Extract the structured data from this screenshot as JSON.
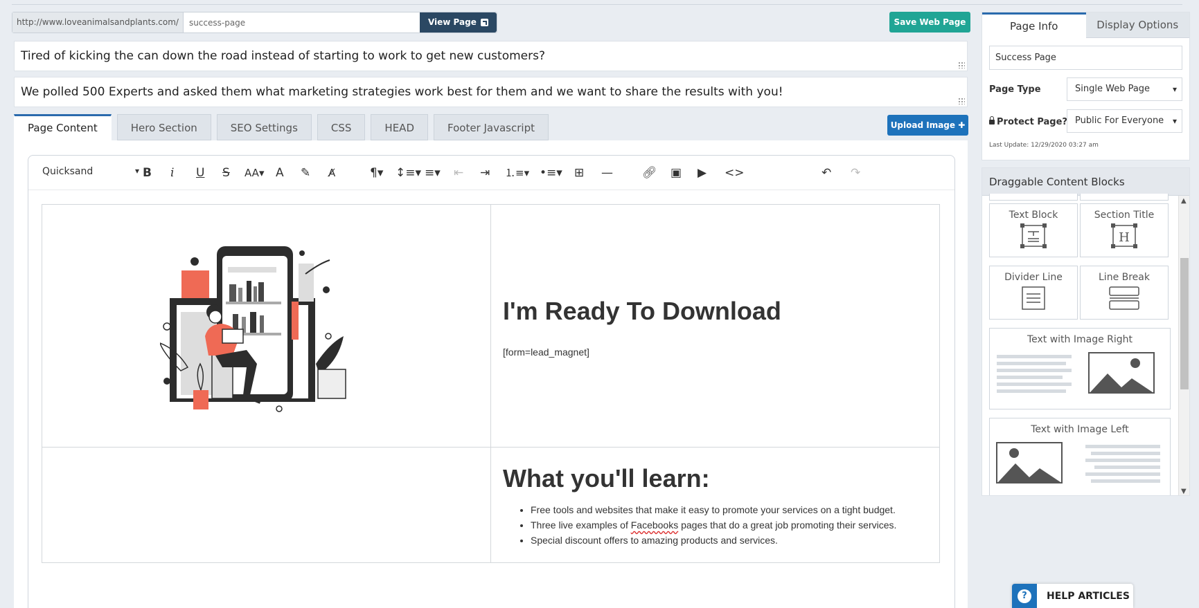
{
  "url_bar": {
    "prefix": "http://www.loveanimalsandplants.com/",
    "slug": "success-page",
    "view_label": "View Page"
  },
  "save_label": "Save Web Page",
  "headline_1": "Tired of kicking the can down the road instead of starting to work to get new customers?",
  "headline_2": "We polled 500 Experts and asked them what marketing strategies work best for them and we want to share the results with you!",
  "tabs": [
    {
      "label": "Page Content",
      "active": true
    },
    {
      "label": "Hero Section"
    },
    {
      "label": "SEO Settings"
    },
    {
      "label": "CSS"
    },
    {
      "label": "HEAD"
    },
    {
      "label": "Footer Javascript"
    }
  ],
  "upload_label": "Upload Image",
  "toolbar": {
    "font": "Quicksand",
    "icons": [
      "bold-icon",
      "italic-icon",
      "underline-icon",
      "strikethrough-icon",
      "font-size-icon",
      "text-color-icon",
      "highlight-icon",
      "clear-format-icon",
      "paragraph-icon",
      "line-height-icon",
      "align-icon",
      "outdent-icon",
      "indent-icon",
      "ordered-list-icon",
      "bullet-list-icon",
      "table-icon",
      "horizontal-rule-icon",
      "link-icon",
      "image-icon",
      "video-icon",
      "code-icon",
      "undo-icon",
      "redo-icon"
    ]
  },
  "content": {
    "ready_title": "I'm Ready To Download",
    "shortcode": "[form=lead_magnet]",
    "learn_title": "What you'll learn:",
    "learn_items": [
      {
        "before": "Free tools and websites that make it easy to promote your services on a tight budget.",
        "squiggle": "",
        "after": ""
      },
      {
        "before": "Three live examples of ",
        "squiggle": "Facebooks",
        "after": " pages that do a great job promoting their services."
      },
      {
        "before": "Special discount offers to amazing products and services.",
        "squiggle": "",
        "after": ""
      }
    ]
  },
  "page_info": {
    "tabs": [
      "Page Info",
      "Display Options"
    ],
    "name": "Success Page",
    "page_type_label": "Page Type",
    "page_type": "Single Web Page",
    "protect_label": "Protect Page?",
    "protect": "Public For Everyone",
    "last_update": "Last Update: 12/29/2020 03:27 am"
  },
  "blocks_panel": {
    "title": "Draggable Content Blocks",
    "blocks": [
      "Text Block",
      "Section Title",
      "Divider Line",
      "Line Break",
      "Text with Image Right",
      "Text with Image Left"
    ]
  },
  "help_label": "HELP ARTICLES",
  "colors": {
    "accent_blue": "#1d72bb",
    "save_green": "#20a595",
    "view_dark": "#2b4863",
    "illustration_red": "#ef6a55"
  }
}
